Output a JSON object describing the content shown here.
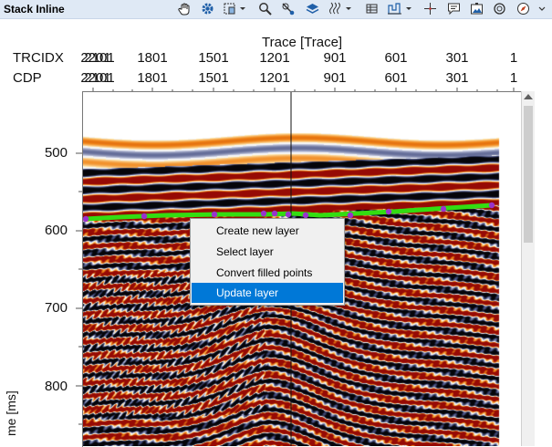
{
  "window": {
    "title": "Stack Inline"
  },
  "toolbar": {
    "icons": [
      "hand-icon",
      "gear-icon",
      "zoom-rect-icon",
      "search-icon",
      "pick-icon",
      "layers-icon",
      "wiggle-icon",
      "colorbar-icon",
      "histogram-icon",
      "crosshair-icon",
      "comment-icon",
      "image-icon",
      "camera-icon",
      "compass-icon"
    ]
  },
  "axis": {
    "title": "Trace [Trace]",
    "row1_label": "TRCIDX",
    "row2_label": "CDP",
    "ticks": [
      "2101",
      "1801",
      "1501",
      "1201",
      "901",
      "601",
      "301",
      "1"
    ],
    "overlap_left": "2201",
    "y_ticks": [
      "500",
      "600",
      "700",
      "800"
    ],
    "y_label": "me [ms]"
  },
  "context_menu": {
    "items": [
      "Create new layer",
      "Select layer",
      "Convert filled points",
      "Update layer"
    ],
    "selected": "Update layer"
  },
  "colors": {
    "horizon": "#33dd11",
    "pick": "#9933cc",
    "highlight": "#0078d7"
  }
}
